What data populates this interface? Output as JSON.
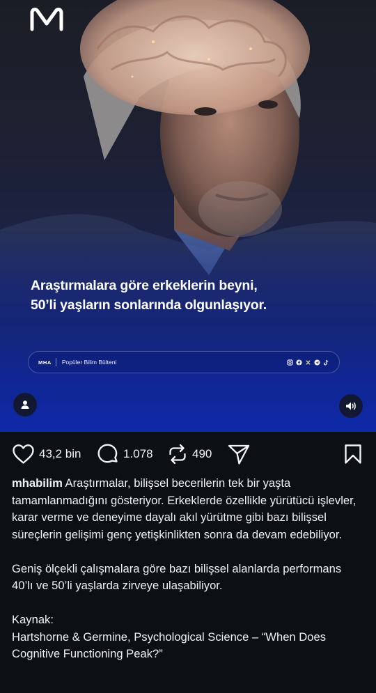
{
  "media": {
    "headline_line1": "Araştırmalara göre erkeklerin beyni,",
    "headline_line2": "50’li yaşların sonlarında olgunlaşıyor.",
    "bulletin_logo": "MHA",
    "bulletin_text": "Popüler Bilim Bülteni",
    "social_icons": [
      "instagram-icon",
      "facebook-icon",
      "x-icon",
      "telegram-icon",
      "tiktok-icon"
    ],
    "accent_color": "#1233b8"
  },
  "actions": {
    "likes": "43,2 bin",
    "comments": "1.078",
    "reposts": "490"
  },
  "caption": {
    "username": "mhabilim",
    "paragraph1": "Araştırmalar, bilişsel becerilerin tek bir yaşta tamamlanmadığını gösteriyor. Erkeklerde özellikle yürütücü işlevler, karar verme ve deneyime dayalı akıl yürütme gibi bazı bilişsel süreçlerin gelişimi genç yetişkinlikten sonra da devam edebiliyor.",
    "paragraph2": "Geniş ölçekli çalışmalara göre bazı bilişsel alanlarda performans 40’lı ve 50’li yaşlarda zirveye ulaşabiliyor.",
    "source_label": "Kaynak:",
    "source_text": "Hartshorne & Germine, Psychological Science – “When Does Cognitive Functioning Peak?”"
  }
}
